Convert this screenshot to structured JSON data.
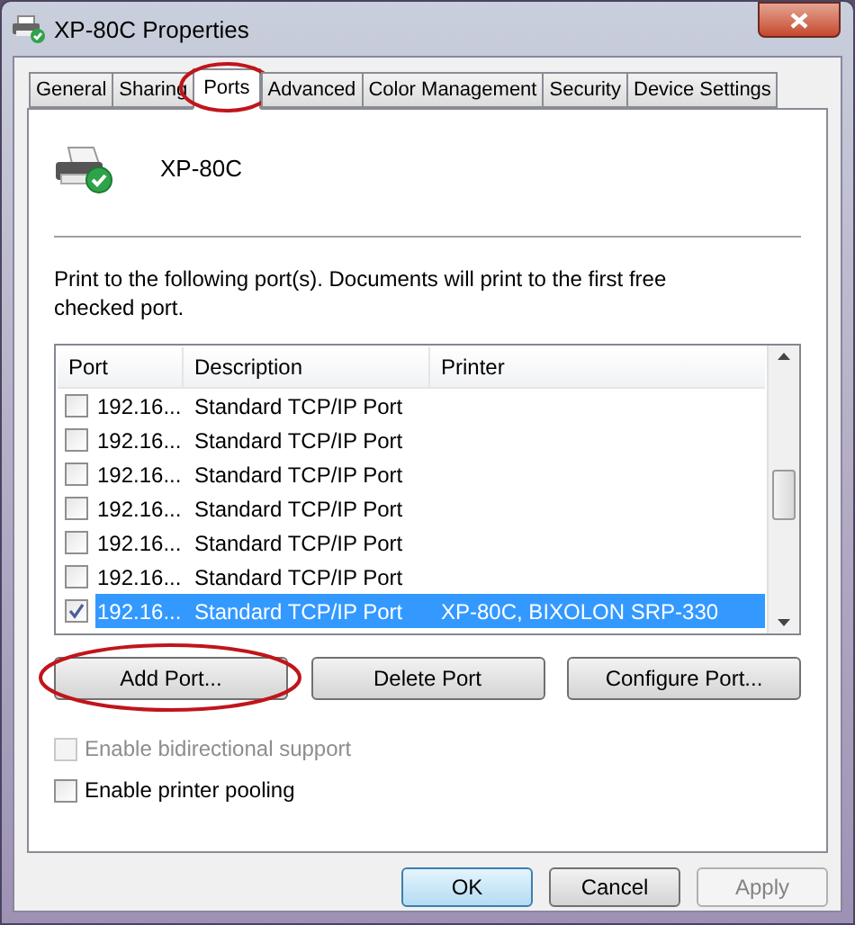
{
  "window": {
    "title": "XP-80C Properties"
  },
  "tabs": [
    {
      "label": "General",
      "selected": false,
      "circled": false
    },
    {
      "label": "Sharing",
      "selected": false,
      "circled": false
    },
    {
      "label": "Ports",
      "selected": true,
      "circled": true
    },
    {
      "label": "Advanced",
      "selected": false,
      "circled": false
    },
    {
      "label": "Color Management",
      "selected": false,
      "circled": false
    },
    {
      "label": "Security",
      "selected": false,
      "circled": false
    },
    {
      "label": "Device Settings",
      "selected": false,
      "circled": false
    }
  ],
  "printer_name": "XP-80C",
  "instructions": "Print to the following port(s). Documents will print to the first free checked port.",
  "port_list": {
    "columns": [
      "Port",
      "Description",
      "Printer"
    ],
    "rows": [
      {
        "port": "192.16...",
        "description": "Standard TCP/IP Port",
        "printer": "",
        "checked": false,
        "selected": false
      },
      {
        "port": "192.16...",
        "description": "Standard TCP/IP Port",
        "printer": "",
        "checked": false,
        "selected": false
      },
      {
        "port": "192.16...",
        "description": "Standard TCP/IP Port",
        "printer": "",
        "checked": false,
        "selected": false
      },
      {
        "port": "192.16...",
        "description": "Standard TCP/IP Port",
        "printer": "",
        "checked": false,
        "selected": false
      },
      {
        "port": "192.16...",
        "description": "Standard TCP/IP Port",
        "printer": "",
        "checked": false,
        "selected": false
      },
      {
        "port": "192.16...",
        "description": "Standard TCP/IP Port",
        "printer": "",
        "checked": false,
        "selected": false
      },
      {
        "port": "192.16...",
        "description": "Standard TCP/IP Port",
        "printer": "XP-80C, BIXOLON SRP-330",
        "checked": true,
        "selected": true
      }
    ]
  },
  "port_buttons": [
    {
      "label": "Add Port...",
      "circled": true
    },
    {
      "label": "Delete Port",
      "circled": false
    },
    {
      "label": "Configure Port...",
      "circled": false
    }
  ],
  "options": [
    {
      "label": "Enable bidirectional support",
      "checked": false,
      "disabled": true
    },
    {
      "label": "Enable printer pooling",
      "checked": false,
      "disabled": false
    }
  ],
  "dialog_buttons": [
    {
      "label": "OK",
      "kind": "default"
    },
    {
      "label": "Cancel",
      "kind": "normal"
    },
    {
      "label": "Apply",
      "kind": "disabled"
    }
  ]
}
